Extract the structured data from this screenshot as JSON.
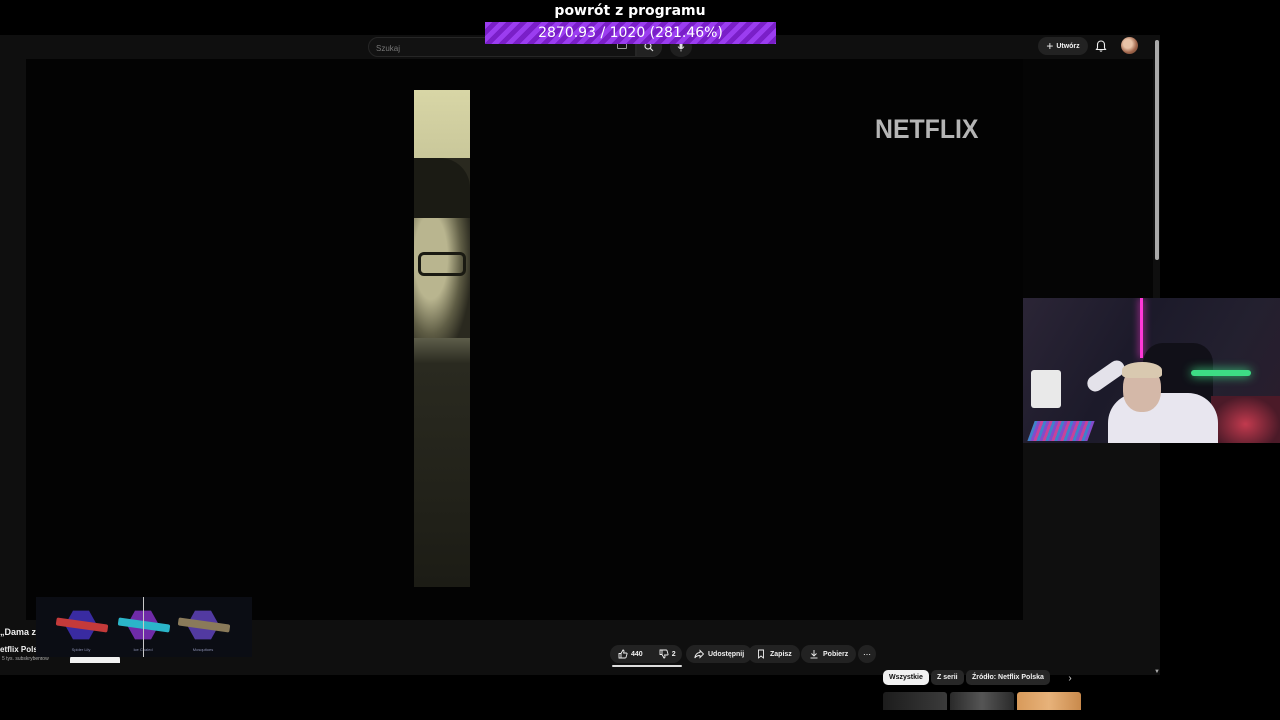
{
  "overlay": {
    "label": "powrót z programu",
    "progress_text": "2870.93 / 1020 (281.46%)",
    "progress_fraction": 2.8146,
    "bar_color": "#8a2be2"
  },
  "masthead": {
    "search_placeholder": "Szukaj",
    "search_icon": "search-icon",
    "keyboard_icon": "keyboard-icon",
    "mic_icon": "mic-icon",
    "create_label": "Utwórz",
    "bell_icon": "bell-icon"
  },
  "player": {
    "watermark": "NETFLIX"
  },
  "actions": {
    "like_count": "440",
    "dislike_count": "2",
    "share_label": "Udostępnij",
    "save_label": "Zapisz",
    "download_label": "Pobierz",
    "more_label": "⋯"
  },
  "chips": [
    "Wszystkie",
    "Z serii",
    "Źródło: Netflix Polska"
  ],
  "channel": {
    "title": "„Dama z",
    "name": "etflix Polsk",
    "subs": "5 tys. subskrybentów"
  },
  "case_items": [
    {
      "name": "Spider Lily",
      "gun_color": "#c43a3a"
    },
    {
      "name": "Ice Coaled",
      "gun_color": "#2bb5c9"
    },
    {
      "name": "Mosquitoes",
      "gun_color": "#8a7a5a"
    }
  ]
}
